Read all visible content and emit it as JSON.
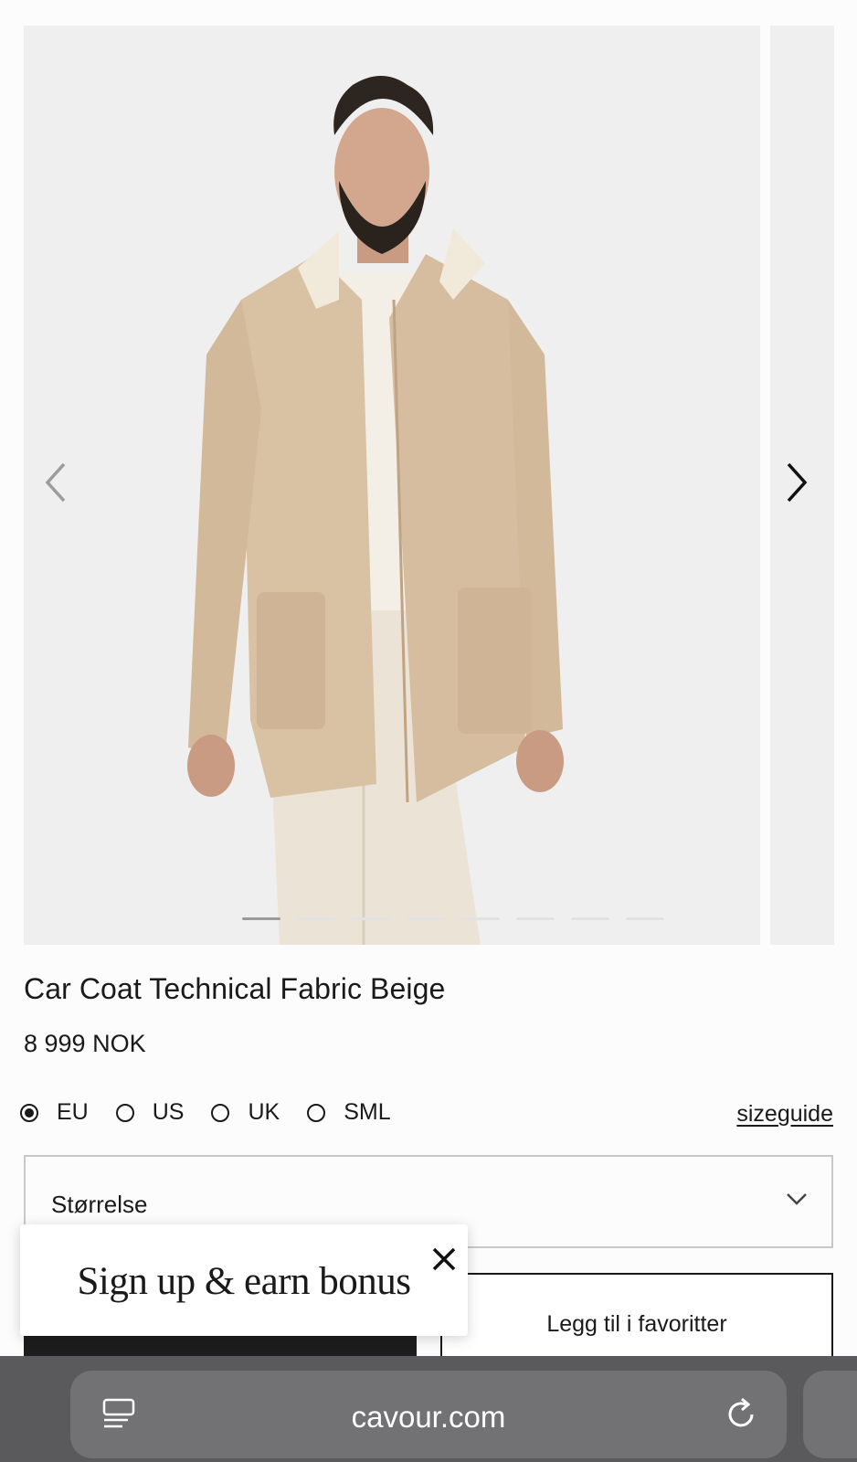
{
  "product": {
    "title": "Car Coat Technical Fabric Beige",
    "price": "8 999 NOK",
    "image_icon": "product-photo-model-in-beige-car-coat",
    "carousel": {
      "count": 8,
      "active_index": 0
    }
  },
  "size_systems": [
    {
      "label": "EU",
      "selected": true
    },
    {
      "label": "US",
      "selected": false
    },
    {
      "label": "UK",
      "selected": false
    },
    {
      "label": "SML",
      "selected": false
    }
  ],
  "sizeguide_label": "sizeguide",
  "size_select": {
    "placeholder": "Størrelse"
  },
  "favorite_button_label": "Legg til i favoritter",
  "popup": {
    "text": "Sign up & earn bonus"
  },
  "browser": {
    "url": "cavour.com"
  },
  "colors": {
    "background": "#fcfcfc",
    "gallery_bg": "#efefef",
    "button_dark": "#1c1c1c",
    "browser_bar": "#5a5a5c",
    "url_pill": "#727275"
  }
}
